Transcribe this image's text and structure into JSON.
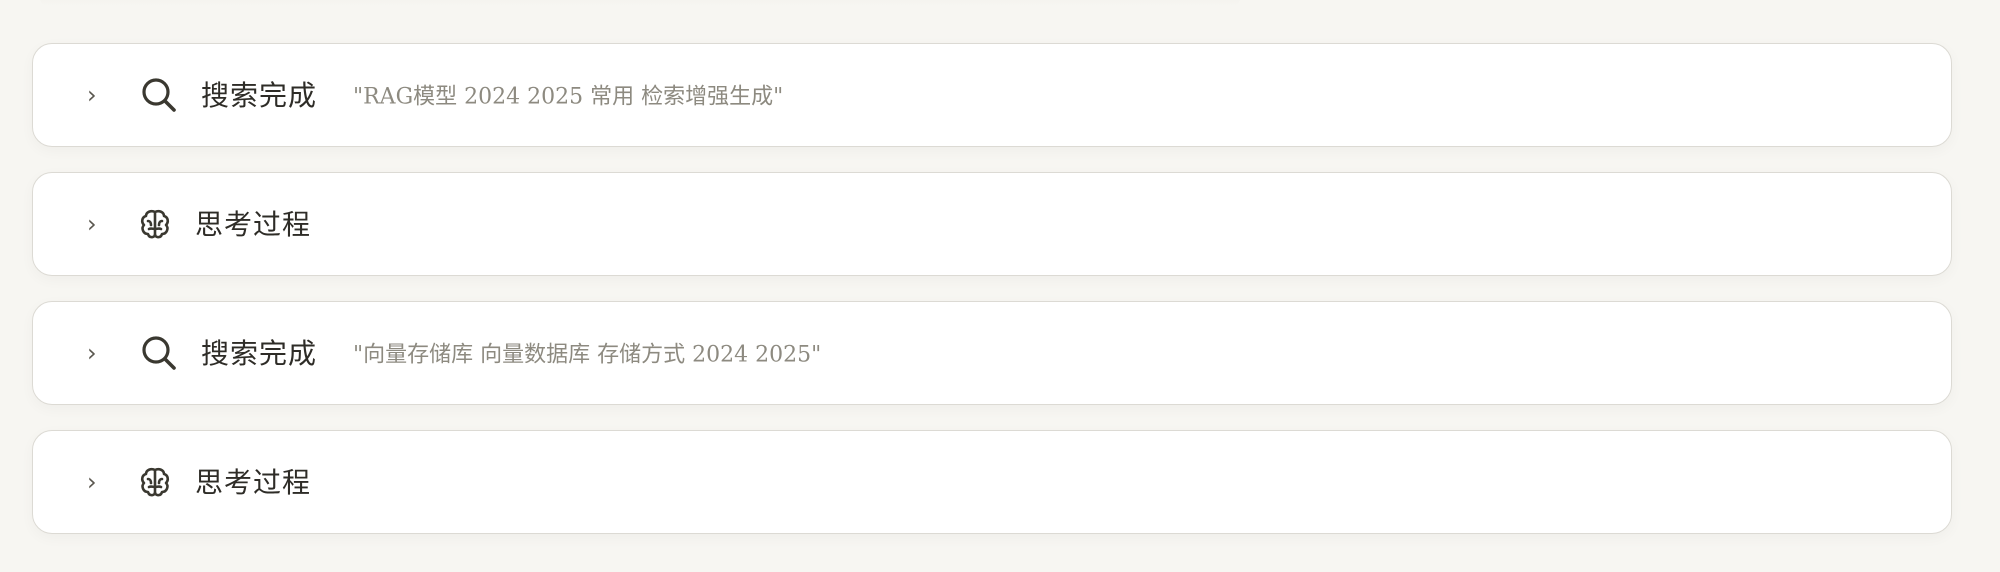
{
  "steps": [
    {
      "kind": "search",
      "icon": "search-icon",
      "title": "搜索完成",
      "query": "\"RAG模型 2024 2025 常用 检索增强生成\""
    },
    {
      "kind": "think",
      "icon": "brain-icon",
      "title": "思考过程"
    },
    {
      "kind": "search",
      "icon": "search-icon",
      "title": "搜索完成",
      "query": "\"向量存储库 向量数据库 存储方式 2024 2025\""
    },
    {
      "kind": "think",
      "icon": "brain-icon",
      "title": "思考过程"
    }
  ],
  "chevron": "›",
  "colors": {
    "background": "#f7f6f2",
    "card": "#ffffff",
    "border": "#dcdad4",
    "title": "#2e2c27",
    "query": "#8d8a80",
    "icon": "#3a3830"
  }
}
